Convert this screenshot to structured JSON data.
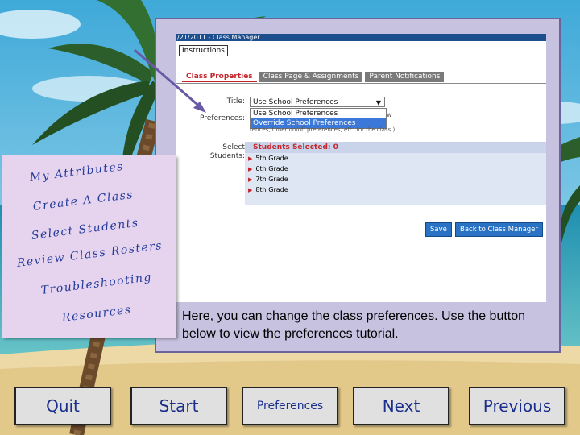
{
  "embedded_screenshot": {
    "title_bar": "/21/2011 - Class Manager",
    "instructions_link": "Instructions",
    "tabs": [
      {
        "label": "Class Properties",
        "active": true
      },
      {
        "label": "Class Page & Assignments",
        "active": false
      },
      {
        "label": "Parent Notifications",
        "active": false
      }
    ],
    "title_label": "Title:",
    "preferences_label": "Preferences:",
    "select_students_label_1": "Select",
    "select_students_label_2": "Students:",
    "title_select_value": "Use School Preferences",
    "dropdown_options": [
      "Use School Preferences",
      "Override School Preferences"
    ],
    "dropdown_selected_index": 1,
    "hint_text": "w",
    "hint_text_2": "rences, timer on/off preferences, etc. for the class.)",
    "students_header": "Students Selected: 0",
    "grades": [
      "5th Grade",
      "6th Grade",
      "7th Grade",
      "8th Grade"
    ],
    "save_button": "Save",
    "back_button": "Back to Class Manager"
  },
  "menu": {
    "items": [
      "My Attributes",
      "Create A Class",
      "Select Students",
      "Review Class Rosters",
      "Troubleshooting",
      "Resources"
    ]
  },
  "caption": "Here, you can change the class preferences.  Use the button below to view the preferences tutorial.",
  "nav": {
    "quit": "Quit",
    "start": "Start",
    "preferences": "Preferences",
    "next": "Next",
    "previous": "Previous"
  },
  "colors": {
    "menu_text": "#233a9a",
    "nav_text": "#1a2e8c",
    "panel_bg": "#c6c2e0",
    "menu_bg": "#e6d4ef",
    "active_tab": "#c4262b",
    "button_blue": "#2a72c4"
  }
}
